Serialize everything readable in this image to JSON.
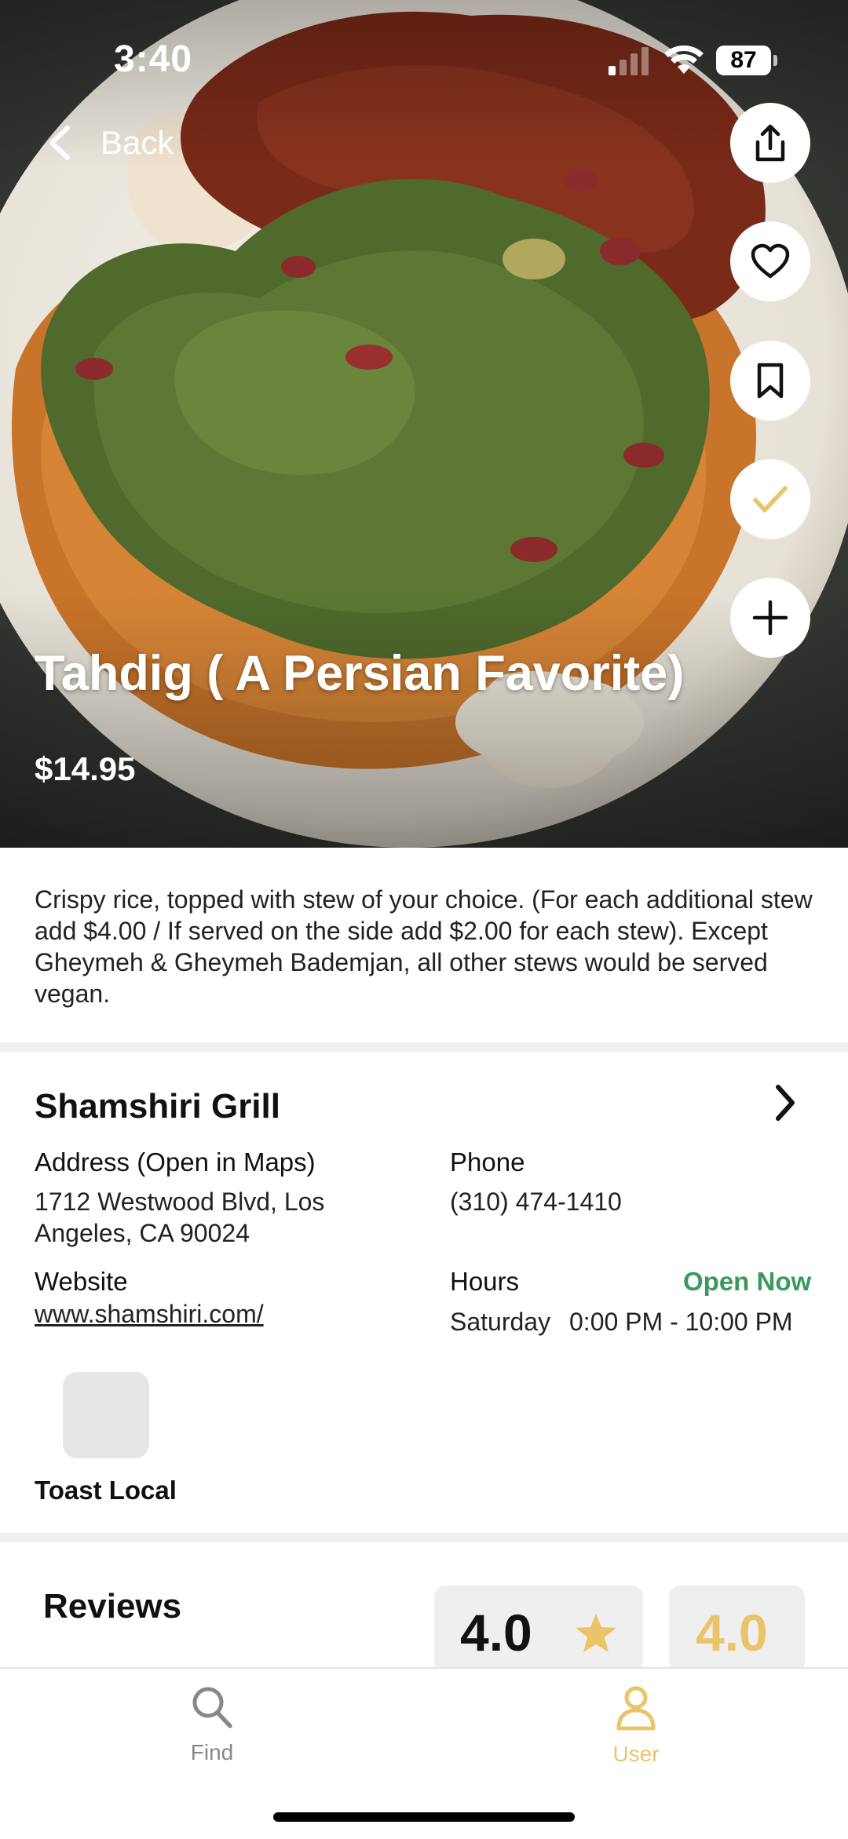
{
  "status_bar": {
    "time": "3:40",
    "battery": "87"
  },
  "nav": {
    "back_label": "Back"
  },
  "item": {
    "title": "Tahdig ( A Persian Favorite)",
    "price": "$14.95",
    "description": "Crispy rice, topped with stew of your choice. (For each additional stew add $4.00 / If served on the side add $2.00 for each stew). Except Gheymeh & Gheymeh Bademjan, all other stews would be served vegan."
  },
  "actions": [
    "share-icon",
    "heart-icon",
    "bookmark-icon",
    "check-icon",
    "plus-icon"
  ],
  "restaurant": {
    "name": "Shamshiri Grill",
    "address_label": "Address (Open in Maps)",
    "address_line1": "1712 Westwood Blvd, Los",
    "address_line2": "Angeles, CA 90024",
    "phone_label": "Phone",
    "phone": "(310) 474-1410",
    "website_label": "Website",
    "website": "www.shamshiri.com/",
    "hours_label": "Hours",
    "open_status": "Open Now",
    "hours_day": "Saturday",
    "hours_time": "0:00 PM - 10:00 PM"
  },
  "partner": {
    "name": "Toast Local"
  },
  "reviews": {
    "title": "Reviews",
    "rating": "4.0",
    "rating_secondary": "4.0"
  },
  "tabs": [
    {
      "label": "Find"
    },
    {
      "label": "User"
    }
  ],
  "colors": {
    "accent": "#EBC46A",
    "open": "#3A9A5C"
  }
}
